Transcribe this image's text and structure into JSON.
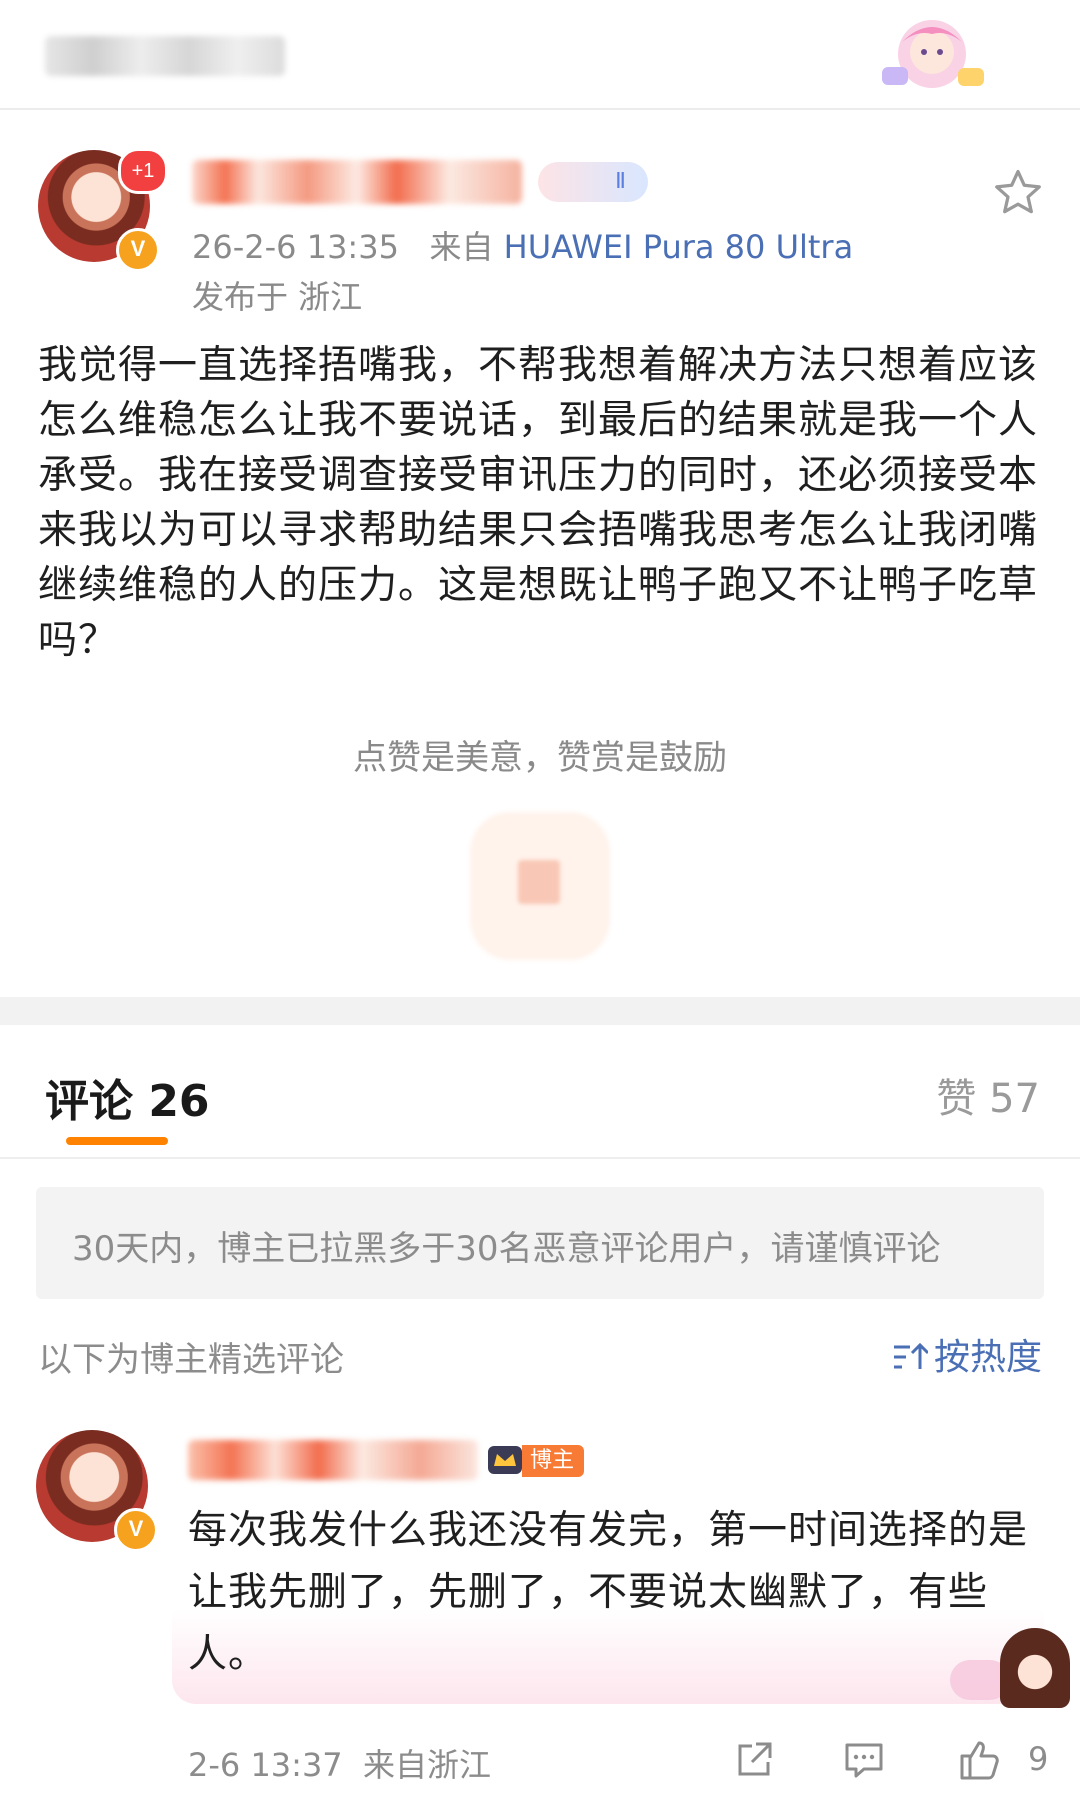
{
  "author": {
    "time": "26-2-6 13:35",
    "from_prefix": "来自",
    "device": "HUAWEI Pura 80 Ultra",
    "location": "发布于 浙江",
    "badge_plus": "+1",
    "level": "Ⅱ"
  },
  "post": {
    "text": "我觉得一直选择捂嘴我，不帮我想着解决方法只想着应该怎么维稳怎么让我不要说话，到最后的结果就是我一个人承受。我在接受调查接受审讯压力的同时，还必须接受本来我以为可以寻求帮助结果只会捂嘴我思考怎么让我闭嘴继续维稳的人的压力。这是想既让鸭子跑又不让鸭子吃草吗？",
    "reward_text": "点赞是美意，赞赏是鼓励"
  },
  "comments_header": {
    "title": "评论 26",
    "likes": "赞 57",
    "notice": "30天内，博主已拉黑多于30名恶意评论用户，请谨慎评论",
    "selected_label": "以下为博主精选评论",
    "sort_label": "按热度"
  },
  "comment": {
    "host_tag": "博主",
    "text": "每次我发什么我还没有发完，第一时间选择的是让我先删了，先删了，不要说太幽默了，有些人。",
    "time": "2-6 13:37",
    "location": "来自浙江",
    "like_count": "9"
  },
  "colors": {
    "accent": "#ff8200",
    "link": "#4a6fb5",
    "host_tag": "#f77a35",
    "verified": "#f6a21e"
  }
}
